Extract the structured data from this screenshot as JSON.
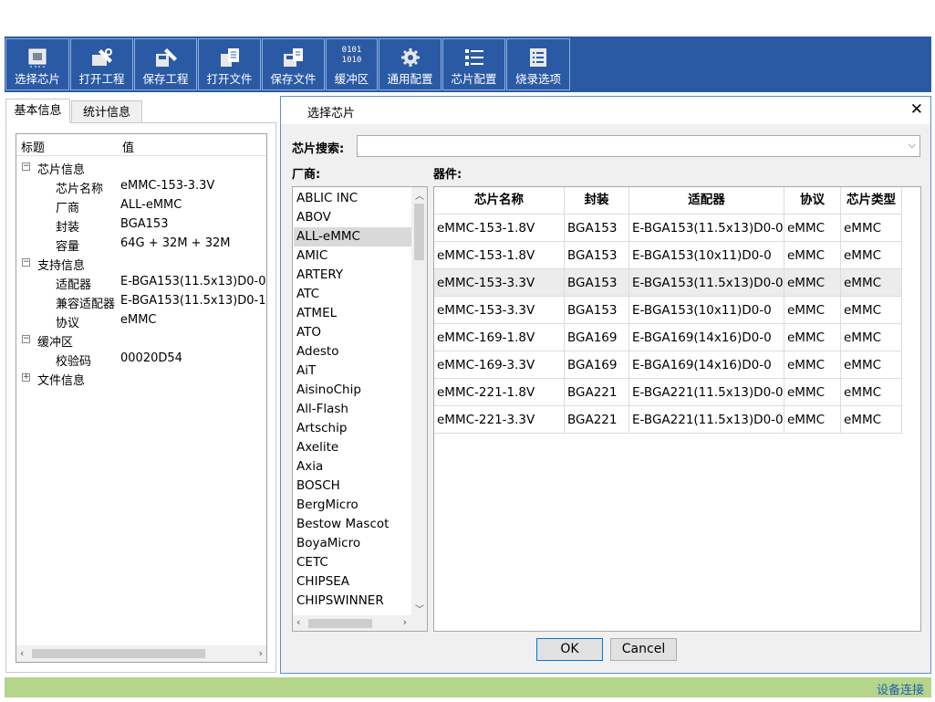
{
  "toolbar": {
    "buttons": [
      {
        "label": "选择芯片",
        "icon": "chip-icon"
      },
      {
        "label": "打开工程",
        "icon": "open-project-icon"
      },
      {
        "label": "保存工程",
        "icon": "save-project-icon"
      },
      {
        "label": "打开文件",
        "icon": "open-file-icon"
      },
      {
        "label": "保存文件",
        "icon": "save-file-icon"
      },
      {
        "label": "缓冲区",
        "icon": "buffer-icon",
        "icon_text_1": "0101",
        "icon_text_2": "1010"
      },
      {
        "label": "通用配置",
        "icon": "gear-icon"
      },
      {
        "label": "芯片配置",
        "icon": "list-icon"
      },
      {
        "label": "烧录选项",
        "icon": "options-icon"
      }
    ]
  },
  "left": {
    "tabs": [
      "基本信息",
      "统计信息"
    ],
    "tree_header": {
      "title": "标题",
      "value": "值"
    },
    "tree": [
      {
        "key": "芯片信息",
        "value": "",
        "expand": "−",
        "level": 0
      },
      {
        "key": "芯片名称",
        "value": "eMMC-153-3.3V",
        "level": 1
      },
      {
        "key": "厂商",
        "value": "ALL-eMMC",
        "level": 1
      },
      {
        "key": "封装",
        "value": "BGA153",
        "level": 1
      },
      {
        "key": "容量",
        "value": "64G + 32M + 32M",
        "level": 1
      },
      {
        "key": "支持信息",
        "value": "",
        "expand": "−",
        "level": 0
      },
      {
        "key": "适配器",
        "value": "E-BGA153(11.5x13)D0-0",
        "level": 1
      },
      {
        "key": "兼容适配器",
        "value": "E-BGA153(11.5x13)D0-1",
        "level": 1
      },
      {
        "key": "协议",
        "value": "eMMC",
        "level": 1
      },
      {
        "key": "缓冲区",
        "value": "",
        "expand": "−",
        "level": 0
      },
      {
        "key": "校验码",
        "value": "00020D54",
        "level": 1
      },
      {
        "key": "文件信息",
        "value": "",
        "expand": "+",
        "level": 0
      }
    ]
  },
  "dialog": {
    "title": "选择芯片",
    "close": "✕",
    "search_label": "芯片搜索:",
    "search_value": "",
    "vendor_label": "厂商:",
    "device_label": "器件:",
    "vendors": [
      "ABLIC INC",
      "ABOV",
      "ALL-eMMC",
      "AMIC",
      "ARTERY",
      "ATC",
      "ATMEL",
      "ATO",
      "Adesto",
      "AiT",
      "AisinoChip",
      "All-Flash",
      "Artschip",
      "Axelite",
      "Axia",
      "BOSCH",
      "BergMicro",
      "Bestow Mascot",
      "BoyaMicro",
      "CETC",
      "CHIPSEA",
      "CHIPSWINNER"
    ],
    "selected_vendor": "ALL-eMMC",
    "columns": [
      "芯片名称",
      "封装",
      "适配器",
      "协议",
      "芯片类型"
    ],
    "rows": [
      [
        "eMMC-153-1.8V",
        "BGA153",
        "E-BGA153(11.5x13)D0-0",
        "eMMC",
        "eMMC"
      ],
      [
        "eMMC-153-1.8V",
        "BGA153",
        "E-BGA153(10x11)D0-0",
        "eMMC",
        "eMMC"
      ],
      [
        "eMMC-153-3.3V",
        "BGA153",
        "E-BGA153(11.5x13)D0-0",
        "eMMC",
        "eMMC"
      ],
      [
        "eMMC-153-3.3V",
        "BGA153",
        "E-BGA153(10x11)D0-0",
        "eMMC",
        "eMMC"
      ],
      [
        "eMMC-169-1.8V",
        "BGA169",
        "E-BGA169(14x16)D0-0",
        "eMMC",
        "eMMC"
      ],
      [
        "eMMC-169-3.3V",
        "BGA169",
        "E-BGA169(14x16)D0-0",
        "eMMC",
        "eMMC"
      ],
      [
        "eMMC-221-1.8V",
        "BGA221",
        "E-BGA221(11.5x13)D0-0",
        "eMMC",
        "eMMC"
      ],
      [
        "eMMC-221-3.3V",
        "BGA221",
        "E-BGA221(11.5x13)D0-0",
        "eMMC",
        "eMMC"
      ]
    ],
    "selected_row": 2,
    "ok_label": "OK",
    "cancel_label": "Cancel"
  },
  "status": {
    "text": "设备连接"
  },
  "colors": {
    "toolbar": "#2b5aa5",
    "status_bar": "#b4d58a",
    "status_text": "#1f5fb3"
  }
}
